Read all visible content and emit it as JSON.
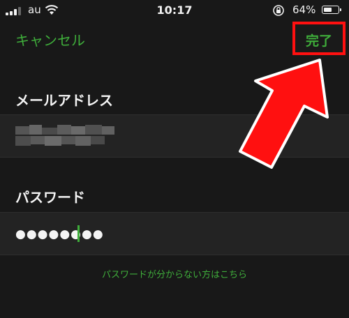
{
  "status_bar": {
    "carrier": "au",
    "time": "10:17",
    "battery_percent": "64%",
    "battery_level": 0.64,
    "icons": [
      "signal-icon",
      "wifi-icon",
      "orientation-lock-icon",
      "battery-icon"
    ]
  },
  "nav": {
    "cancel_label": "キャンセル",
    "done_label": "完了"
  },
  "form": {
    "email_label": "メールアドレス",
    "email_value_obscured": true,
    "password_label": "パスワード",
    "password_value": "●●●●●●●●",
    "forgot_password_link": "パスワードが分からない方はこちら"
  },
  "annotations": {
    "highlight_color": "#ff1010",
    "arrow_color": "#ff1010",
    "accent_color": "#3fae3b"
  }
}
